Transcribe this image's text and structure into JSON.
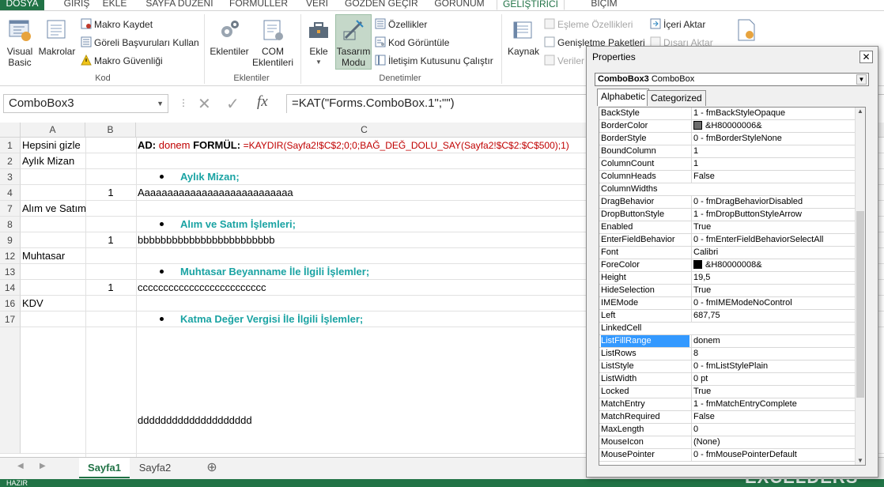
{
  "ribbon_tabs": [
    "DOSYA",
    "GİRİŞ",
    "EKLE",
    "SAYFA DÜZENİ",
    "FORMÜLLER",
    "VERİ",
    "GÖZDEN GEÇİR",
    "GÖRÜNÜM",
    "GELİŞTİRİCİ",
    "BİÇİM"
  ],
  "ribbon": {
    "kod": {
      "visual_basic": "Visual Basic",
      "makrolar": "Makrolar",
      "makro_kaydet": "Makro Kaydet",
      "goreli": "Göreli Başvuruları Kullan",
      "makro_guvenligi": "Makro Güvenliği",
      "label": "Kod"
    },
    "eklentiler": {
      "eklentiler": "Eklentiler",
      "com": "COM Eklentileri",
      "label": "Eklentiler"
    },
    "denetimler": {
      "ekle": "Ekle",
      "tasarim": "Tasarım Modu",
      "ozellikler": "Özellikler",
      "kod_goruntule": "Kod Görüntüle",
      "iletisim": "İletişim Kutusunu Çalıştır",
      "label": "Denetimler"
    },
    "xml": {
      "kaynak": "Kaynak",
      "esleme": "Eşleme Özellikleri",
      "genisletme": "Genişletme Paketleri",
      "veriler": "Veriler",
      "iceri": "İçeri Aktar",
      "disari": "Dışarı Aktar"
    }
  },
  "formula_bar": {
    "name_box": "ComboBox3",
    "formula": "=KAT(\"Forms.ComboBox.1\";\"\")"
  },
  "columns": [
    "A",
    "B",
    "C"
  ],
  "rows": [
    {
      "num": "1",
      "a": "Hepsini gizle",
      "b": "",
      "c_ad": "AD:",
      "c_name": "donem",
      "c_formul": "FORMÜL:",
      "c_formula": "=KAYDIR(Sayfa2!$C$2;0;0;BAĞ_DEĞ_DOLU_SAY(Sayfa2!$C$2:$C$500);1)"
    },
    {
      "num": "2",
      "a": "Aylık Mizan",
      "b": "",
      "c": ""
    },
    {
      "num": "3",
      "a": "",
      "b": "",
      "bullet": "Aylık Mizan;"
    },
    {
      "num": "4",
      "a": "",
      "b": "1",
      "c": "Aaaaaaaaaaaaaaaaaaaaaaaaaaa"
    },
    {
      "num": "7",
      "a": "Alım ve Satım",
      "b": "",
      "c": ""
    },
    {
      "num": "8",
      "a": "",
      "b": "",
      "bullet": "Alım ve Satım İşlemleri;"
    },
    {
      "num": "9",
      "a": "",
      "b": "1",
      "c": "bbbbbbbbbbbbbbbbbbbbbbbb"
    },
    {
      "num": "12",
      "a": "Muhtasar",
      "b": "",
      "c": ""
    },
    {
      "num": "13",
      "a": "",
      "b": "",
      "bullet": "Muhtasar Beyanname İle İlgili İşlemler;"
    },
    {
      "num": "14",
      "a": "",
      "b": "1",
      "c": "ccccccccccccccccccccccccc"
    },
    {
      "num": "16",
      "a": "KDV",
      "b": "",
      "c": ""
    },
    {
      "num": "17",
      "a": "",
      "b": "",
      "bullet": "Katma Değer Vergisi İle İlgili İşlemler;"
    },
    {
      "num": "",
      "a": "",
      "b": "",
      "c": "dddddddddddddddddddd"
    }
  ],
  "sheets": {
    "active": "Sayfa1",
    "other": "Sayfa2",
    "add": "⊕"
  },
  "status": "HAZIR",
  "properties": {
    "title": "Properties",
    "object": "ComboBox3",
    "object_type": "ComboBox",
    "tab_alpha": "Alphabetic",
    "tab_cat": "Categorized",
    "items": [
      {
        "name": "BackStyle",
        "value": "1 - fmBackStyleOpaque"
      },
      {
        "name": "BorderColor",
        "value": "&H80000006&",
        "swatch": "#6b6b6b"
      },
      {
        "name": "BorderStyle",
        "value": "0 - fmBorderStyleNone"
      },
      {
        "name": "BoundColumn",
        "value": "1"
      },
      {
        "name": "ColumnCount",
        "value": "1"
      },
      {
        "name": "ColumnHeads",
        "value": "False"
      },
      {
        "name": "ColumnWidths",
        "value": ""
      },
      {
        "name": "DragBehavior",
        "value": "0 - fmDragBehaviorDisabled"
      },
      {
        "name": "DropButtonStyle",
        "value": "1 - fmDropButtonStyleArrow"
      },
      {
        "name": "Enabled",
        "value": "True"
      },
      {
        "name": "EnterFieldBehavior",
        "value": "0 - fmEnterFieldBehaviorSelectAll"
      },
      {
        "name": "Font",
        "value": "Calibri"
      },
      {
        "name": "ForeColor",
        "value": "&H80000008&",
        "swatch": "#000000"
      },
      {
        "name": "Height",
        "value": "19,5"
      },
      {
        "name": "HideSelection",
        "value": "True"
      },
      {
        "name": "IMEMode",
        "value": "0 - fmIMEModeNoControl"
      },
      {
        "name": "Left",
        "value": "687,75"
      },
      {
        "name": "LinkedCell",
        "value": ""
      },
      {
        "name": "ListFillRange",
        "value": "donem",
        "selected": true
      },
      {
        "name": "ListRows",
        "value": "8"
      },
      {
        "name": "ListStyle",
        "value": "0 - fmListStylePlain"
      },
      {
        "name": "ListWidth",
        "value": "0 pt"
      },
      {
        "name": "Locked",
        "value": "True"
      },
      {
        "name": "MatchEntry",
        "value": "1 - fmMatchEntryComplete"
      },
      {
        "name": "MatchRequired",
        "value": "False"
      },
      {
        "name": "MaxLength",
        "value": "0"
      },
      {
        "name": "MouseIcon",
        "value": "(None)"
      },
      {
        "name": "MousePointer",
        "value": "0 - fmMousePointerDefault"
      }
    ]
  },
  "logo": "EXCELDERS",
  "colors": {
    "excel_green": "#217346",
    "accent_teal": "#1aa3a3",
    "formula_red": "#c00000",
    "selection_blue": "#3399ff"
  }
}
